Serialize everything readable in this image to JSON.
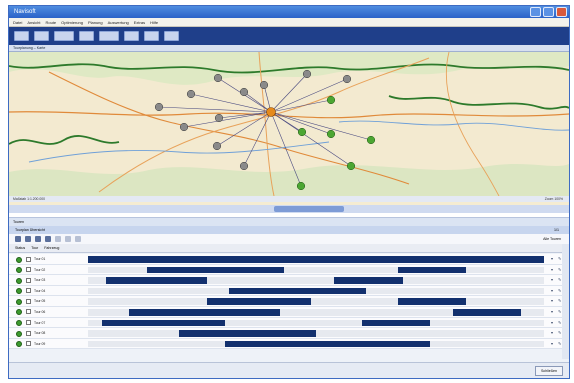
{
  "window": {
    "title": "Navisoft"
  },
  "menu": [
    "Datei",
    "Ansicht",
    "Route",
    "Optimierung",
    "Planung",
    "Auswertung",
    "Extras",
    "Hilfe"
  ],
  "map": {
    "header": "Tourplanung – Karte",
    "footer_left": "Maßstab 1:1.200.000",
    "footer_right": "Zoom 100%"
  },
  "panel": {
    "title": "Touren",
    "gantt_title": "Tourplan Übersicht",
    "gantt_title_right": "1/1",
    "tools_right": "Alle Touren",
    "column_status": "Status",
    "column_name": "Tour",
    "column_resource": "Fahrzeug"
  },
  "statusbar": {
    "button_label": "Schließen"
  },
  "gantt_rows": [
    {
      "label": "Tour 01",
      "bars": [
        [
          0.0,
          1.0
        ]
      ]
    },
    {
      "label": "Tour 02",
      "bars": [
        [
          0.13,
          0.43
        ],
        [
          0.68,
          0.83
        ]
      ]
    },
    {
      "label": "Tour 03",
      "bars": [
        [
          0.04,
          0.26
        ],
        [
          0.54,
          0.69
        ]
      ]
    },
    {
      "label": "Tour 04",
      "bars": [
        [
          0.31,
          0.61
        ]
      ]
    },
    {
      "label": "Tour 05",
      "bars": [
        [
          0.26,
          0.49
        ],
        [
          0.68,
          0.83
        ]
      ]
    },
    {
      "label": "Tour 06",
      "bars": [
        [
          0.09,
          0.42
        ],
        [
          0.8,
          0.95
        ]
      ]
    },
    {
      "label": "Tour 07",
      "bars": [
        [
          0.03,
          0.3
        ],
        [
          0.6,
          0.75
        ]
      ]
    },
    {
      "label": "Tour 08",
      "bars": [
        [
          0.2,
          0.5
        ]
      ]
    },
    {
      "label": "Tour 09",
      "bars": [
        [
          0.3,
          0.75
        ]
      ]
    }
  ],
  "colors": {
    "bar": "#12306e",
    "title_blue": "#2a62c8",
    "status_green": "#3c9a2e"
  }
}
